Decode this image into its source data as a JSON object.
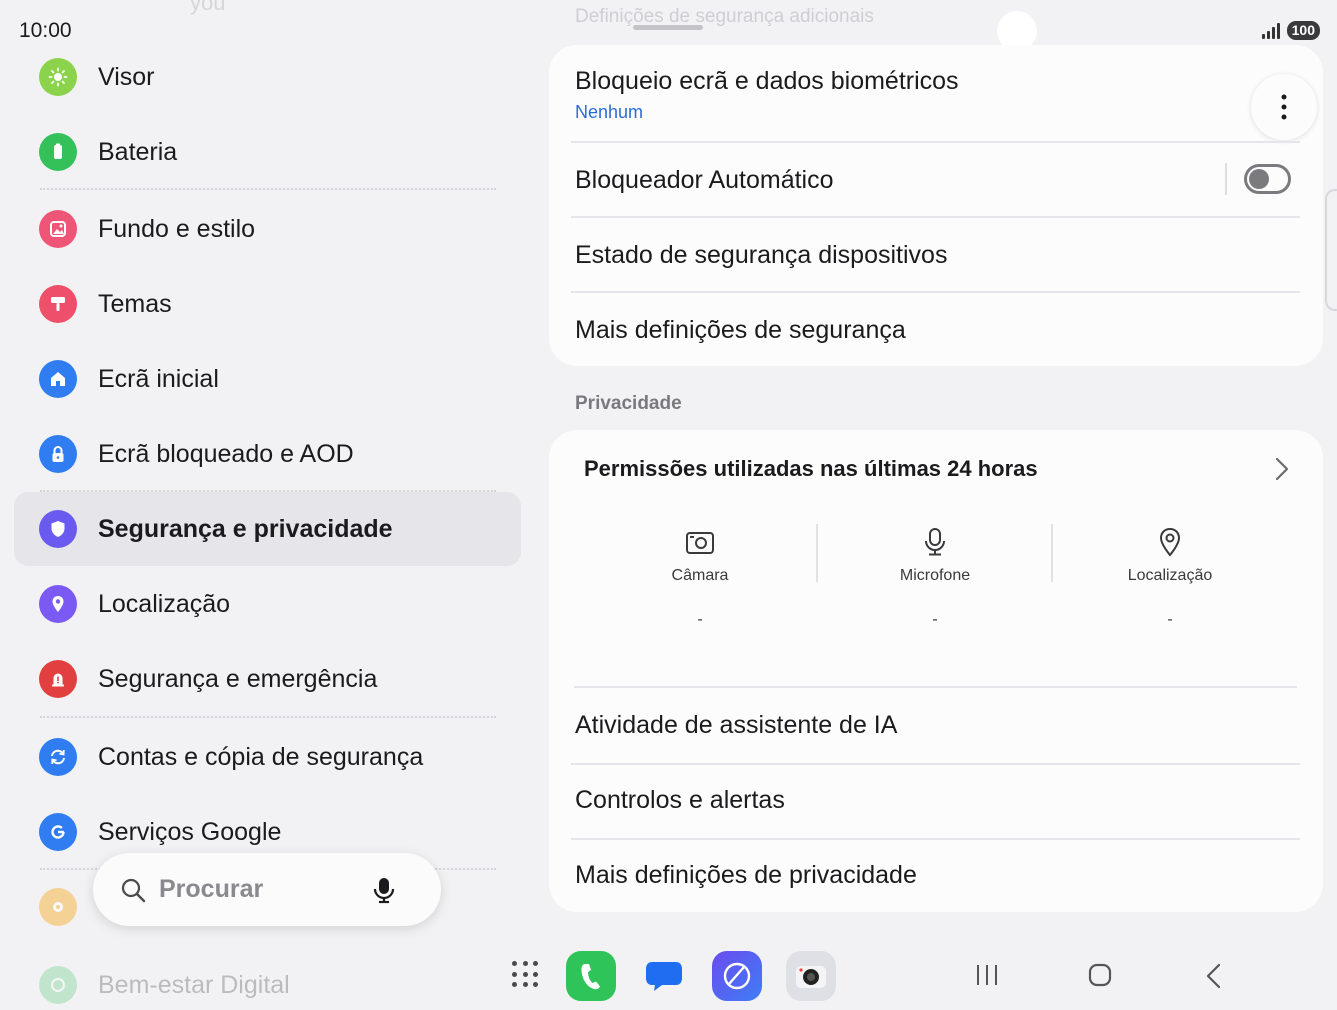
{
  "status": {
    "time": "10:00",
    "battery": "100"
  },
  "ghost": {
    "left_text": "you",
    "top_text": "Definições de segurança adicionais"
  },
  "sidebar": {
    "items": [
      {
        "label": "Visor",
        "color": "#8bd34a"
      },
      {
        "label": "Bateria",
        "color": "#34c15a"
      },
      {
        "label": "Fundo e estilo",
        "color": "#ee5577"
      },
      {
        "label": "Temas",
        "color": "#ee4f6a"
      },
      {
        "label": "Ecrã inicial",
        "color": "#2f7df0"
      },
      {
        "label": "Ecrã bloqueado e AOD",
        "color": "#2f7df0"
      },
      {
        "label": "Segurança e privacidade",
        "color": "#6a5af0",
        "active": true
      },
      {
        "label": "Localização",
        "color": "#7a5af2"
      },
      {
        "label": "Segurança e emergência",
        "color": "#e24040"
      },
      {
        "label": "Contas e cópia de segurança",
        "color": "#2f7df0"
      },
      {
        "label": "Serviços Google",
        "color": "#2f7df0"
      },
      {
        "label": "",
        "color": "#f6b84a"
      },
      {
        "label": "Bem-estar Digital",
        "color": "#34c15a"
      }
    ]
  },
  "search": {
    "placeholder": "Procurar"
  },
  "security_card": {
    "lock_title": "Bloqueio ecrã e dados biométricos",
    "lock_sub": "Nenhum",
    "auto_blocker": "Bloqueador Automático",
    "auto_blocker_on": false,
    "device_state": "Estado de segurança dispositivos",
    "more_security": "Mais definições de segurança"
  },
  "privacy": {
    "section_label": "Privacidade",
    "perm_title": "Permissões utilizadas nas últimas 24 horas",
    "perms": [
      {
        "label": "Câmara",
        "value": "-"
      },
      {
        "label": "Microfone",
        "value": "-"
      },
      {
        "label": "Localização",
        "value": "-"
      }
    ],
    "ai_activity": "Atividade de assistente de IA",
    "controls": "Controlos e alertas",
    "more_privacy": "Mais definições de privacidade"
  }
}
